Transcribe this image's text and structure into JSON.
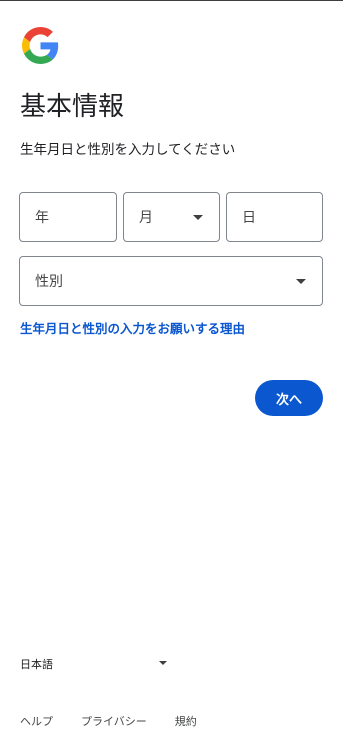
{
  "logo": {
    "icon": "google-g-logo",
    "colors": [
      "#4285F4",
      "#EA4335",
      "#FBBC05",
      "#34A853"
    ]
  },
  "header": {
    "title": "基本情報",
    "subtitle": "生年月日と性別を入力してください"
  },
  "birthday": {
    "year_label": "年",
    "month_label": "月",
    "day_label": "日"
  },
  "gender": {
    "label": "性別"
  },
  "links": {
    "why": "生年月日と性別の入力をお願いする理由"
  },
  "actions": {
    "next_label": "次へ",
    "accent_color": "#0b57d0"
  },
  "footer": {
    "language": "日本語",
    "help": "ヘルプ",
    "privacy": "プライバシー",
    "terms": "規約"
  }
}
